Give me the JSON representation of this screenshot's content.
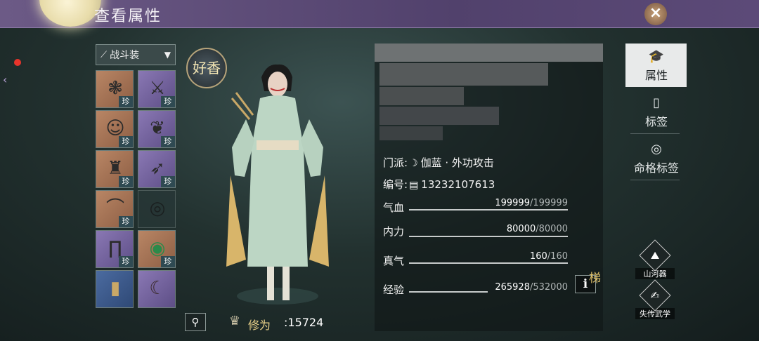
{
  "header": {
    "title": "查看属性",
    "close_label": "×"
  },
  "outfit": {
    "selected": "战斗装",
    "icon": "dagger-icon"
  },
  "equipment": [
    {
      "name": "prayer-beads",
      "glyph": "❃",
      "rarity": "珍"
    },
    {
      "name": "dagger",
      "glyph": "⚔",
      "rarity": "珍"
    },
    {
      "name": "head-hair",
      "glyph": "☺",
      "rarity": "珍"
    },
    {
      "name": "pendant",
      "glyph": "❦",
      "rarity": "珍"
    },
    {
      "name": "robe",
      "glyph": "♜",
      "rarity": "珍"
    },
    {
      "name": "gauntlet",
      "glyph": "➶",
      "rarity": "珍"
    },
    {
      "name": "belt",
      "glyph": "⌒",
      "rarity": "珍"
    },
    {
      "name": "rings",
      "glyph": "◎",
      "rarity": ""
    },
    {
      "name": "trousers",
      "glyph": "∏",
      "rarity": "珍"
    },
    {
      "name": "bracelet",
      "glyph": "◉",
      "rarity": "珍"
    },
    {
      "name": "boots",
      "glyph": "▮",
      "rarity": ""
    },
    {
      "name": "crescent-blade",
      "glyph": "☾",
      "rarity": ""
    }
  ],
  "character": {
    "emblem_text": "好香",
    "cultivation_label": "修为",
    "cultivation_value": "15724",
    "zoom_icon": "magnifier-icon"
  },
  "info": {
    "sect_label": "门派:",
    "sect_value": "伽蓝 · 外功攻击",
    "id_label": "编号:",
    "id_value": "13232107613"
  },
  "stats": [
    {
      "label": "气血",
      "current": "199999",
      "max": "/199999",
      "fill": 1.0
    },
    {
      "label": "内力",
      "current": "80000",
      "max": "/80000",
      "fill": 1.0
    },
    {
      "label": "真气",
      "current": "160",
      "max": "/160",
      "fill": 1.0
    },
    {
      "label": "经验",
      "current": "265928",
      "max": "/532000",
      "fill": 0.5
    }
  ],
  "ladder": {
    "info_label": "i",
    "ladder_label": "梯"
  },
  "tabs": [
    {
      "label": "属性",
      "icon": "hat-icon",
      "active": true
    },
    {
      "label": "标签",
      "icon": "tag-icon",
      "active": false
    },
    {
      "label": "命格标签",
      "icon": "fate-icon",
      "active": false
    }
  ],
  "side_buttons": [
    {
      "label": "山河器",
      "icon": "artifact-icon"
    },
    {
      "label": "失传武学",
      "icon": "martial-art-icon"
    }
  ],
  "colors": {
    "accent_gold": "#e9d18a",
    "title_bar": "#5c4a78",
    "orange_slot": "#b98665",
    "purple_slot": "#8a78b4"
  }
}
